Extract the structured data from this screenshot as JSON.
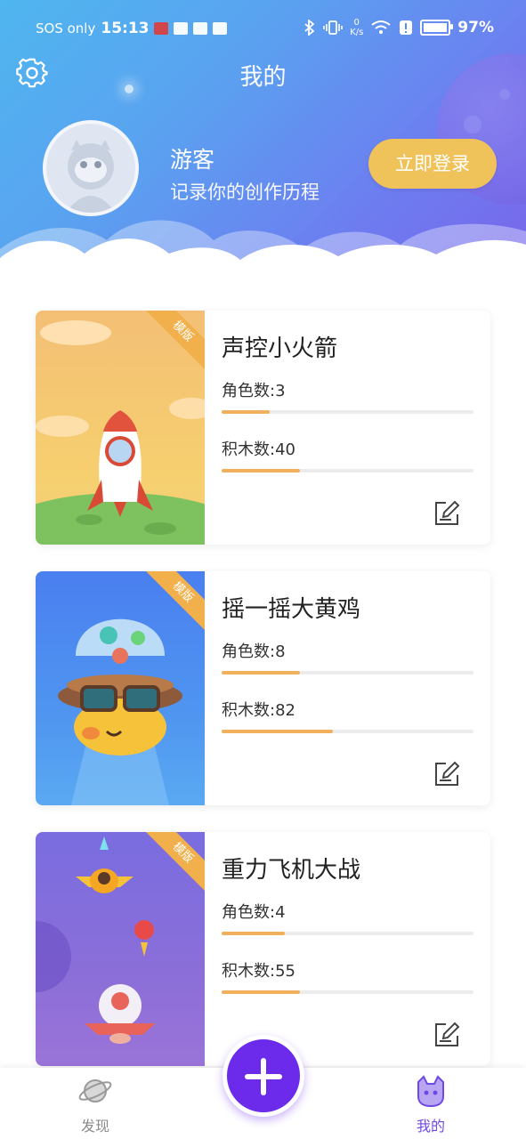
{
  "status_bar": {
    "carrier": "SOS only",
    "time": "15:13",
    "net_speed_value": "0",
    "net_speed_unit": "K/s",
    "battery": "97%",
    "battery_level": 0.97
  },
  "header": {
    "title": "我的"
  },
  "profile": {
    "name": "游客",
    "subtitle": "记录你的创作历程",
    "login_label": "立即登录"
  },
  "projects": [
    {
      "title": "声控小火箭",
      "badge": "模版",
      "roles_label": "角色数:3",
      "blocks_label": "积木数:40",
      "roles_progress": 0.19,
      "blocks_progress": 0.31
    },
    {
      "title": "摇一摇大黄鸡",
      "badge": "模版",
      "roles_label": "角色数:8",
      "blocks_label": "积木数:82",
      "roles_progress": 0.31,
      "blocks_progress": 0.44
    },
    {
      "title": "重力飞机大战",
      "badge": "模版",
      "roles_label": "角色数:4",
      "blocks_label": "积木数:55",
      "roles_progress": 0.25,
      "blocks_progress": 0.31
    }
  ],
  "bottom_nav": {
    "discover_label": "发现",
    "mine_label": "我的"
  },
  "colors": {
    "accent": "#6c2bea",
    "login_button": "#f0c35a",
    "progress": "#f0b05c",
    "badge": "#f2b04c"
  }
}
